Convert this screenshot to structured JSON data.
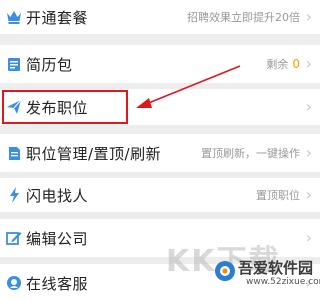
{
  "menu": {
    "items": [
      {
        "label": "开通套餐",
        "hint": "招聘效果立即提升20倍",
        "icon": "crown-icon",
        "color": "#3b8fe0"
      },
      {
        "label": "简历包",
        "hint": "剩余",
        "count": "0",
        "icon": "resume-package-icon",
        "color": "#3b8fe0"
      },
      {
        "label": "发布职位",
        "hint": "",
        "icon": "send-plane-icon",
        "color": "#3b8fe0"
      },
      {
        "label": "职位管理/置顶/刷新",
        "hint": "置顶刷新，一键操作",
        "icon": "document-list-icon",
        "color": "#3b8fe0"
      },
      {
        "label": "闪电找人",
        "hint": "置顶职位",
        "icon": "lightning-icon",
        "color": "#3b8fe0"
      },
      {
        "label": "编辑公司",
        "hint": "",
        "icon": "edit-icon",
        "color": "#3b8fe0"
      },
      {
        "label": "在线客服",
        "hint": "",
        "icon": "customer-service-icon",
        "color": "#3b8fe0"
      }
    ]
  },
  "annotation": {
    "color": "#e0181e"
  },
  "watermark": {
    "big_text": "KK下载",
    "site_name": "吾爱软件园",
    "site_url": "www.52zixue.com"
  }
}
